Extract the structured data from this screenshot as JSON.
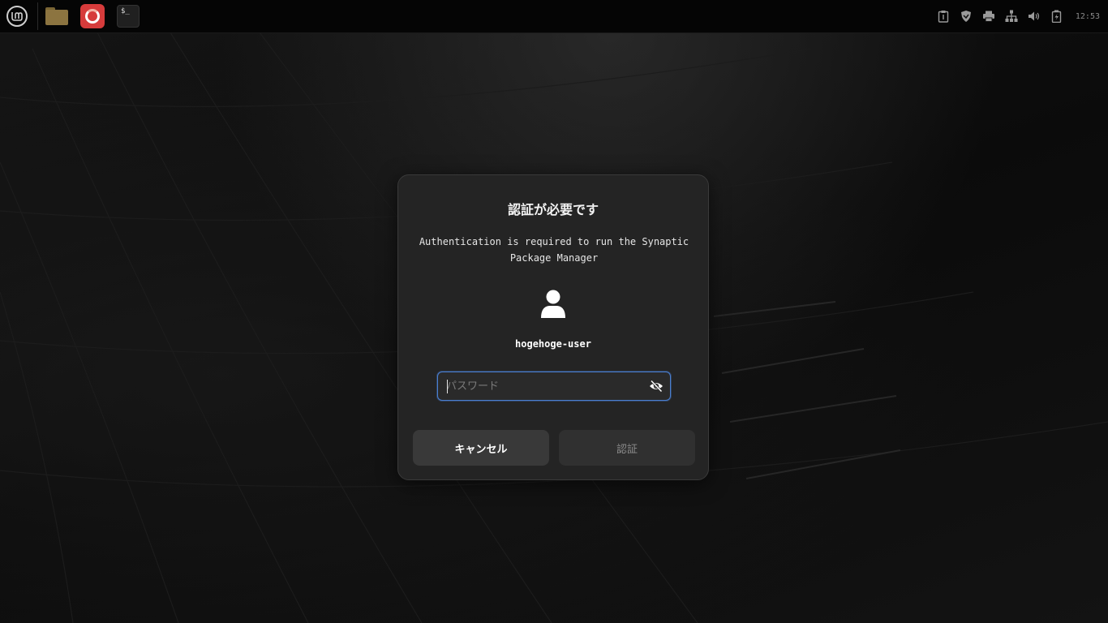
{
  "panel": {
    "menu_icon": "linux-mint-logo-icon",
    "launchers": [
      {
        "name": "Files",
        "icon": "folder-icon"
      },
      {
        "name": "Web Browser",
        "icon": "browser-icon"
      },
      {
        "name": "Terminal",
        "icon": "terminal-icon"
      }
    ],
    "tray_icons": [
      "clipboard-icon",
      "shield-icon",
      "printer-icon",
      "network-icon",
      "volume-icon",
      "battery-icon"
    ],
    "clock": "12:53"
  },
  "dialog": {
    "title": "認証が必要です",
    "message": "Authentication is required to run the Synaptic Package Manager",
    "avatar_icon": "user-avatar-icon",
    "username": "hogehoge-user",
    "password": {
      "value": "",
      "placeholder": "パスワード"
    },
    "reveal_icon": "eye-slash-icon",
    "cancel_label": "キャンセル",
    "authenticate_label": "認証"
  },
  "colors": {
    "dialog_bg": "#242424",
    "focus_accent": "#4a7fd1",
    "panel_bg": "#050505"
  }
}
